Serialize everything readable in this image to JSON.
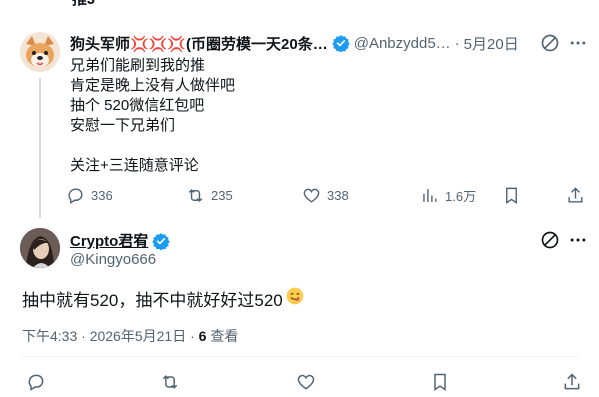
{
  "cut_text": "推J",
  "reply_tweet": {
    "author_name": "狗头军师💢💢💢(币圈劳模一天20条…",
    "handle": "@Anbzydd5…",
    "date": "5月20日",
    "lines": [
      "兄弟们能刷到我的推",
      "肯定是晚上没有人做伴吧",
      "抽个 520微信红包吧",
      "安慰一下兄弟们",
      "",
      "关注+三连随意评论"
    ],
    "replies": "336",
    "retweets": "235",
    "likes": "338",
    "views": "1.6万"
  },
  "main_tweet": {
    "author_name": "Crypto君宥",
    "handle": "@Kingyo666",
    "text": "抽中就有520，抽不中就好好过520",
    "time": "下午4:33 · 2026年5月21日 · ",
    "views_count": "6",
    "views_label": " 查看"
  },
  "colors": {
    "accent": "#1d9bf0",
    "secondary_text": "#536471",
    "border": "#cfd9de"
  },
  "icons": [
    "grok-icon",
    "more-icon",
    "reply-icon",
    "retweet-icon",
    "like-icon",
    "views-icon",
    "bookmark-icon",
    "share-icon",
    "verified-icon"
  ]
}
